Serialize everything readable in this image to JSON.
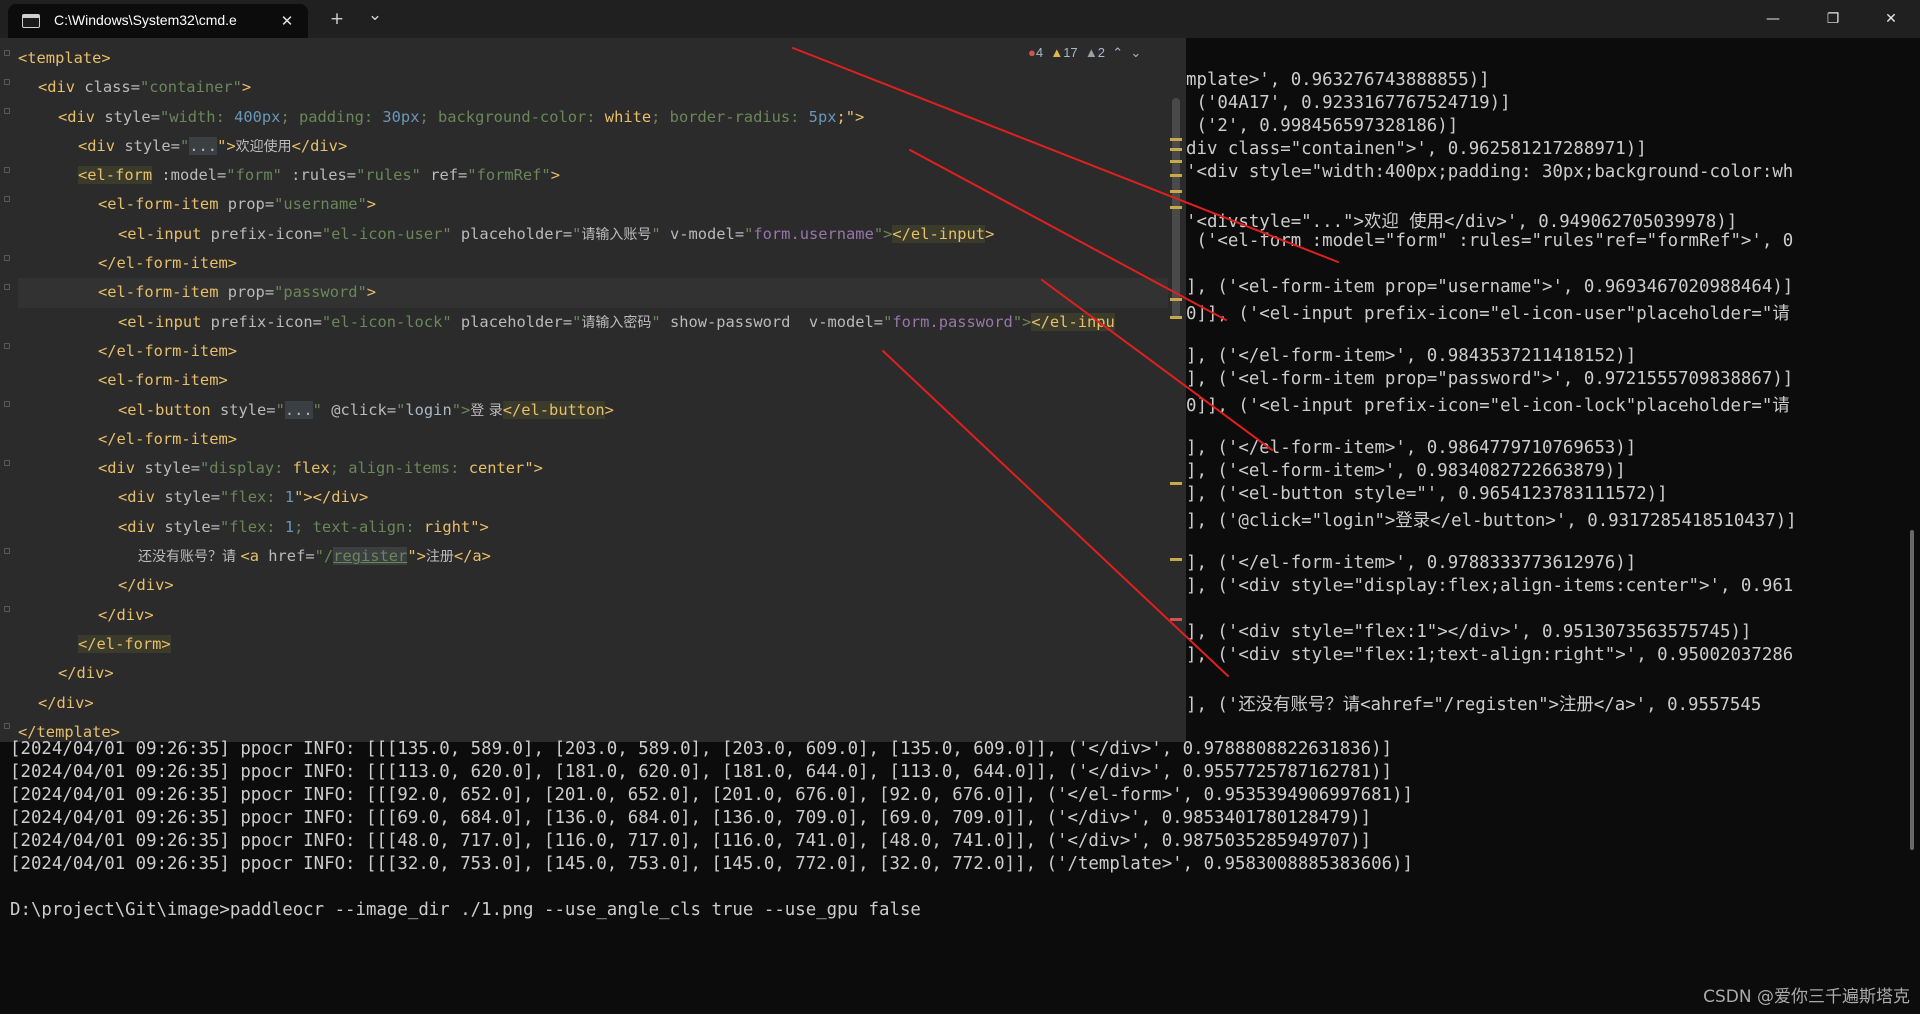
{
  "window": {
    "tab_title": "C:\\Windows\\System32\\cmd.e",
    "tab_close": "✕",
    "new_tab": "+",
    "tab_dropdown": "⌄",
    "minimize": "—",
    "maximize": "❐",
    "close": "✕"
  },
  "editor": {
    "inspection": {
      "errors": "4",
      "warnings": "17",
      "weak_warnings": "2"
    },
    "code": {
      "l1": {
        "a": "<template>"
      },
      "l2": {
        "a": "<div ",
        "b": "class",
        "c": "=",
        "d": "\"container\"",
        "e": ">"
      },
      "l3": {
        "a": "<div ",
        "b": "style",
        "c": "=",
        "d": "\"width: ",
        "e": "400px",
        "f": "; padding: ",
        "g": "30px",
        "h": "; background-color: ",
        "i": "white",
        "j": "; border-radius: ",
        "k": "5px",
        "l": ";\">"
      },
      "l4": {
        "a": "<div ",
        "b": "style",
        "c": "=",
        "d": "\"",
        "e": "...",
        "f": "\">",
        "g": "欢迎使用",
        "h": "</div>"
      },
      "l5": {
        "a": "<el-form",
        "b": " :model",
        "c": "=",
        "d": "\"form\"",
        "e": " :rules",
        "f": "=",
        "g": "\"rules\"",
        "h": " ref",
        "i": "=",
        "j": "\"formRef\"",
        "k": ">"
      },
      "l6": {
        "a": "<el-form-item",
        "b": " prop",
        "c": "=",
        "d": "\"username\"",
        "e": ">"
      },
      "l7": {
        "a": "<el-input",
        "b": " prefix-icon",
        "c": "=",
        "d": "\"el-icon-user\"",
        "e": " placeholder",
        "f": "=",
        "g": "\"",
        "h": "请输入账号",
        "i": "\"",
        "j": " v-model",
        "k": "=",
        "l": "\"",
        "m": "form.username",
        "n": "\">",
        "o": "</el-input",
        "p": ">"
      },
      "l8": {
        "a": "</el-form-item>"
      },
      "l9": {
        "a": "<el-form-item",
        "b": " prop",
        "c": "=",
        "d": "\"password\"",
        "e": ">"
      },
      "l10": {
        "a": "<el-input",
        "b": " prefix-icon",
        "c": "=",
        "d": "\"el-icon-lock\"",
        "e": " placeholder",
        "f": "=",
        "g": "\"",
        "h": "请输入密码",
        "i": "\"",
        "j": " show-password  v-model",
        "k": "=",
        "l": "\"",
        "m": "form.password",
        "n": "\">",
        "o": "</el-inpu"
      },
      "l11": {
        "a": "</el-form-item>"
      },
      "l12": {
        "a": "<el-form-item>"
      },
      "l13": {
        "a": "<el-button",
        "b": " style",
        "c": "=",
        "d": "\"",
        "e": "...",
        "f": "\"",
        "g": " @click",
        "h": "=",
        "i": "\"",
        "j": "login",
        "k": "\">",
        "l": "登 录",
        "m": "</el-button",
        "n": ">"
      },
      "l14": {
        "a": "</el-form-item>"
      },
      "l15": {
        "a": "<div ",
        "b": "style",
        "c": "=",
        "d": "\"display: ",
        "e": "flex",
        "f": "; align-items: ",
        "g": "center",
        "h": "\">"
      },
      "l16": {
        "a": "<div ",
        "b": "style",
        "c": "=",
        "d": "\"flex: ",
        "e": "1",
        "f": "\">",
        "g": "</div>"
      },
      "l17": {
        "a": "<div ",
        "b": "style",
        "c": "=",
        "d": "\"flex: ",
        "e": "1",
        "f": "; text-align: ",
        "g": "right",
        "h": "\">"
      },
      "l18": {
        "a": "还没有账号？请 ",
        "b": "<a ",
        "c": "href",
        "d": "=",
        "e": "\"/",
        "f": "register",
        "g": "\">",
        "h": "注册",
        "i": "</a>"
      },
      "l19": {
        "a": "</div>"
      },
      "l20": {
        "a": "</div>"
      },
      "l21": {
        "a": "</el-form>"
      },
      "l22": {
        "a": "</div>"
      },
      "l23": {
        "a": "</div>"
      },
      "l24": {
        "a": "</template>"
      }
    }
  },
  "right_output": [
    "mplate>', 0.963276743888855)]",
    " ('04A17', 0.9233167767524719)]",
    " ('2', 0.998456597328186)]",
    "div class=\"containen\">', 0.962581217288971)]",
    "'<div style=\"width:400px;padding: 30px;background-color:wh",
    "'<divstyle=\"...\">欢迎 使用</div>', 0.949062705039978)]",
    " ('<el-form :model=\"form\" :rules=\"rules\"ref=\"formRef\">', 0",
    "], ('<el-form-item prop=\"username\">', 0.9693467020988464)]",
    "0]], ('<el-input prefix-icon=\"el-icon-user\"placeholder=\"请",
    "], ('</el-form-item>', 0.9843537211418152)]",
    "], ('<el-form-item prop=\"password\">', 0.9721555709838867)]",
    "0]], ('<el-input prefix-icon=\"el-icon-lock\"placeholder=\"请",
    "], ('</el-form-item>', 0.9864779710769653)]",
    "], ('<el-form-item>', 0.9834082722663879)]",
    "], ('<el-button style=\"', 0.9654123783111572)]",
    "], ('@click=\"login\">登录</el-button>', 0.9317285418510437)]",
    "], ('</el-form-item>', 0.9788333773612976)]",
    "], ('<div style=\"display:flex;align-items:center\">', 0.961",
    "], ('<div style=\"flex:1\"></div>', 0.9513073563575745)]",
    "], ('<div style=\"flex:1;text-align:right\">', 0.95002037286",
    "], ('还没有账号？请<ahref=\"/registen\">注册</a>', 0.9557545"
  ],
  "bottom_output": [
    "[2024/04/01 09:26:35] ppocr INFO: [[[135.0, 589.0], [203.0, 589.0], [203.0, 609.0], [135.0, 609.0]], ('</div>', 0.9788808822631836)]",
    "[2024/04/01 09:26:35] ppocr INFO: [[[113.0, 620.0], [181.0, 620.0], [181.0, 644.0], [113.0, 644.0]], ('</div>', 0.9557725787162781)]",
    "[2024/04/01 09:26:35] ppocr INFO: [[[92.0, 652.0], [201.0, 652.0], [201.0, 676.0], [92.0, 676.0]], ('</el-form>', 0.9535394906997681)]",
    "[2024/04/01 09:26:35] ppocr INFO: [[[69.0, 684.0], [136.0, 684.0], [136.0, 709.0], [69.0, 709.0]], ('</div>', 0.9853401780128479)]",
    "[2024/04/01 09:26:35] ppocr INFO: [[[48.0, 717.0], [116.0, 717.0], [116.0, 741.0], [48.0, 741.0]], ('</div>', 0.9875035285949707)]",
    "[2024/04/01 09:26:35] ppocr INFO: [[[32.0, 753.0], [145.0, 753.0], [145.0, 772.0], [32.0, 772.0]], ('/template>', 0.9583008885383606)]"
  ],
  "prompt": "D:\\project\\Git\\image>paddleocr --image_dir ./1.png --use_angle_cls true --use_gpu false",
  "watermark": "CSDN @爱你三千遍斯塔克",
  "colors": {
    "terminal_bg": "#0c0c0c",
    "titlebar_bg": "#202020",
    "editor_bg": "#2b2b2b",
    "tag": "#e8bf6a",
    "string": "#6a8759",
    "number": "#6897bb",
    "annotation_arrow": "#e0201e"
  }
}
